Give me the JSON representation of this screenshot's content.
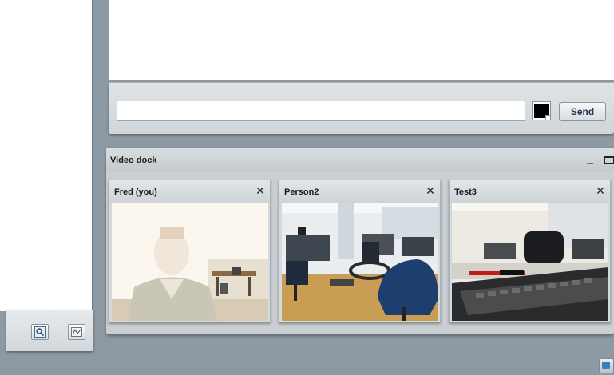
{
  "left_toolbar": {
    "buttons": [
      {
        "icon": "magnifier-icon"
      },
      {
        "icon": "chart-line-icon"
      }
    ]
  },
  "chat": {
    "input_value": "",
    "text_color": "#000000",
    "send_label": "Send"
  },
  "video_dock": {
    "title": "Video dock",
    "minimize_glyph": "_",
    "tiles": [
      {
        "name": "Fred (you)",
        "close_glyph": "✕"
      },
      {
        "name": "Person2",
        "close_glyph": "✕"
      },
      {
        "name": "Test3",
        "close_glyph": "✕"
      }
    ]
  },
  "colors": {
    "background": "#8e9aa3",
    "panel": "#d3d8dc",
    "send_text": "#1e3a55"
  }
}
